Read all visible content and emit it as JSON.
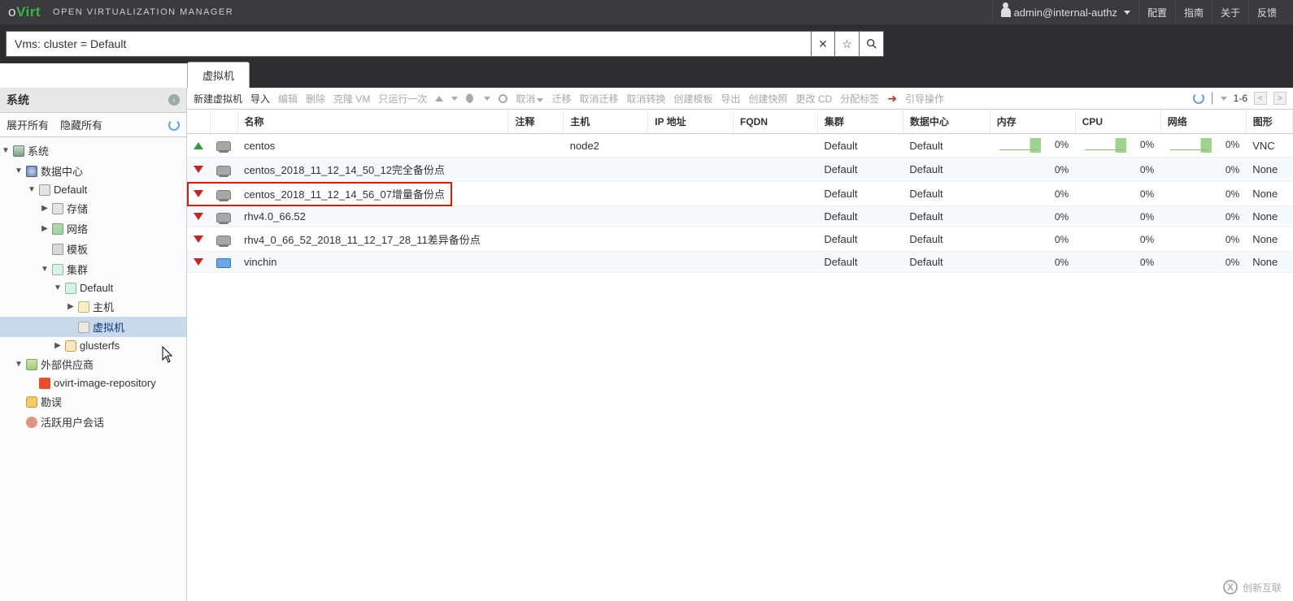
{
  "header": {
    "logo_o": "o",
    "logo_virt": "Virt",
    "tagline": "OPEN VIRTUALIZATION MANAGER",
    "user": "admin@internal-authz",
    "links": [
      "配置",
      "指南",
      "关于",
      "反馈"
    ]
  },
  "search": {
    "value": "Vms: cluster = Default",
    "clear": "✕",
    "star": "☆",
    "go": "🔍"
  },
  "tab": {
    "label": "虚拟机"
  },
  "sidebar": {
    "title": "系统",
    "expand_all": "展开所有",
    "collapse_all": "隐藏所有",
    "nodes": {
      "system": "系统",
      "datacenters": "数据中心",
      "default_dc": "Default",
      "storage": "存储",
      "network": "网络",
      "template": "模板",
      "clusters": "集群",
      "default_cluster": "Default",
      "host": "主机",
      "vm": "虚拟机",
      "glusterfs": "glusterfs",
      "providers": "外部供应商",
      "repo": "ovirt-image-repository",
      "errata": "勘误",
      "sessions": "活跃用户会话"
    }
  },
  "toolbar": {
    "new_vm": "新建虚拟机",
    "import": "导入",
    "edit": "编辑",
    "delete": "删除",
    "clone": "克隆 VM",
    "runonce": "只运行一次",
    "migrate": "迁移",
    "cancel_migrate": "取消迁移",
    "cancel_convert": "取消转换",
    "make_template": "创建模板",
    "export": "导出",
    "snapshot": "创建快照",
    "change_cd": "更改 CD",
    "assign_tag": "分配标签",
    "guide": "引导操作",
    "cancel_txt": "取消",
    "page": "1-6"
  },
  "columns": [
    "",
    "",
    "名称",
    "注释",
    "主机",
    "IP 地址",
    "FQDN",
    "集群",
    "数据中心",
    "内存",
    "CPU",
    "网络",
    "图形"
  ],
  "rows": [
    {
      "status": "up",
      "type": "desk",
      "name": "centos",
      "host": "node2",
      "cluster": "Default",
      "dc": "Default",
      "mem": "0%",
      "cpu": "0%",
      "net": "0%",
      "gfx": "VNC",
      "spark": true
    },
    {
      "status": "down",
      "type": "desk",
      "name": "centos_2018_11_12_14_50_12完全备份点",
      "host": "",
      "cluster": "Default",
      "dc": "Default",
      "mem": "0%",
      "cpu": "0%",
      "net": "0%",
      "gfx": "None",
      "spark": false
    },
    {
      "status": "down",
      "type": "desk",
      "name": "centos_2018_11_12_14_56_07增量备份点",
      "host": "",
      "cluster": "Default",
      "dc": "Default",
      "mem": "0%",
      "cpu": "0%",
      "net": "0%",
      "gfx": "None",
      "spark": false,
      "highlight": true
    },
    {
      "status": "down",
      "type": "desk",
      "name": "rhv4.0_66.52",
      "host": "",
      "cluster": "Default",
      "dc": "Default",
      "mem": "0%",
      "cpu": "0%",
      "net": "0%",
      "gfx": "None",
      "spark": false
    },
    {
      "status": "down",
      "type": "desk",
      "name": "rhv4_0_66_52_2018_11_12_17_28_11差异备份点",
      "host": "",
      "cluster": "Default",
      "dc": "Default",
      "mem": "0%",
      "cpu": "0%",
      "net": "0%",
      "gfx": "None",
      "spark": false
    },
    {
      "status": "down",
      "type": "srv",
      "name": "vinchin",
      "host": "",
      "cluster": "Default",
      "dc": "Default",
      "mem": "0%",
      "cpu": "0%",
      "net": "0%",
      "gfx": "None",
      "spark": false
    }
  ],
  "watermark": "创新互联"
}
